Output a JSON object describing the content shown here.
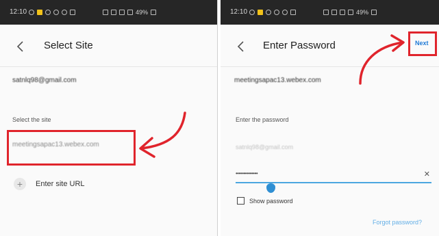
{
  "statusbar": {
    "time": "12:10",
    "battery": "49%"
  },
  "left": {
    "title": "Select Site",
    "email": "satnlq98@gmail.com",
    "select_label": "Select the site",
    "site": "meetingsapac13.webex.com",
    "add_site_label": "Enter site URL"
  },
  "right": {
    "title": "Enter Password",
    "next_label": "Next",
    "site": "meetingsapac13.webex.com",
    "password_label": "Enter the password",
    "username": "satnlq98@gmail.com",
    "password_value": "••••••••••••••",
    "show_password_label": "Show password",
    "forgot_label": "Forgot password?"
  },
  "colors": {
    "highlight": "#e0242c",
    "accent": "#1f7ad6",
    "field_underline": "#4aa6e0"
  }
}
